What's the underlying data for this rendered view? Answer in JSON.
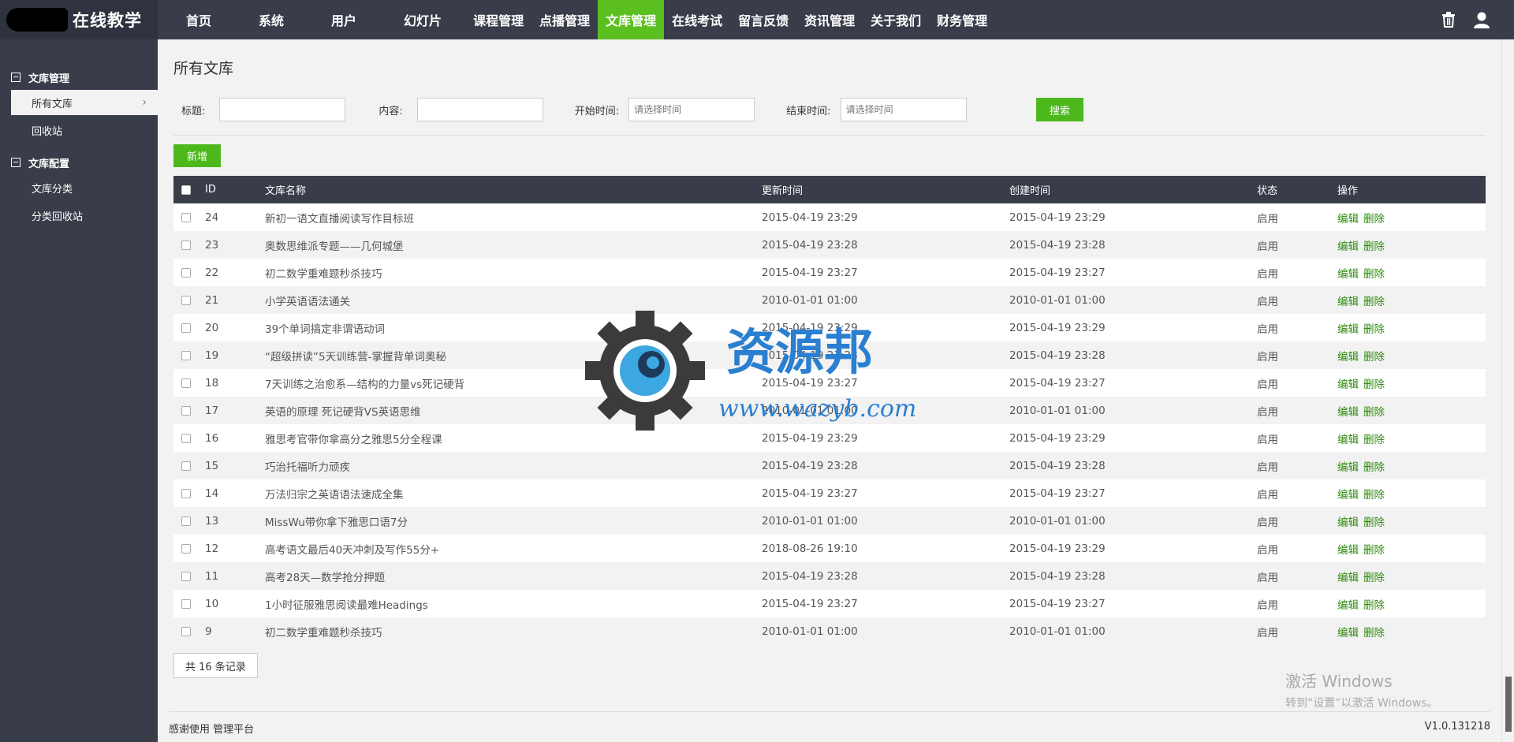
{
  "app": {
    "title": "在线教学"
  },
  "nav": [
    {
      "label": "首页",
      "wide": true
    },
    {
      "label": "系统",
      "wide": true
    },
    {
      "label": "用户",
      "wide": true
    },
    {
      "label": "幻灯片",
      "wide": true
    },
    {
      "label": "课程管理"
    },
    {
      "label": "点播管理"
    },
    {
      "label": "文库管理",
      "active": true
    },
    {
      "label": "在线考试"
    },
    {
      "label": "留言反馈"
    },
    {
      "label": "资讯管理"
    },
    {
      "label": "关于我们"
    },
    {
      "label": "财务管理"
    }
  ],
  "sidebar": {
    "groups": [
      {
        "label": "文库管理",
        "items": [
          {
            "label": "所有文库",
            "active": true
          },
          {
            "label": "回收站"
          }
        ]
      },
      {
        "label": "文库配置",
        "items": [
          {
            "label": "文库分类"
          },
          {
            "label": "分类回收站"
          }
        ]
      }
    ]
  },
  "page": {
    "title": "所有文库"
  },
  "filter": {
    "title_label": "标题:",
    "content_label": "内容:",
    "start_label": "开始时间:",
    "start_placeholder": "请选择时间",
    "end_label": "结束时间:",
    "end_placeholder": "请选择时间",
    "search_label": "搜索"
  },
  "toolbar": {
    "add_label": "新增"
  },
  "table": {
    "headers": {
      "id": "ID",
      "name": "文库名称",
      "updated": "更新时间",
      "created": "创建时间",
      "status": "状态",
      "ops": "操作"
    },
    "edit_label": "编辑",
    "delete_label": "删除",
    "rows": [
      {
        "id": "24",
        "name": "新初一语文直播阅读写作目标班",
        "updated": "2015-04-19 23:29",
        "created": "2015-04-19 23:29",
        "status": "启用"
      },
      {
        "id": "23",
        "name": "奥数思维派专题——几何城堡",
        "updated": "2015-04-19 23:28",
        "created": "2015-04-19 23:28",
        "status": "启用"
      },
      {
        "id": "22",
        "name": "初二数学重难题秒杀技巧",
        "updated": "2015-04-19 23:27",
        "created": "2015-04-19 23:27",
        "status": "启用"
      },
      {
        "id": "21",
        "name": "小学英语语法通关",
        "updated": "2010-01-01 01:00",
        "created": "2010-01-01 01:00",
        "status": "启用"
      },
      {
        "id": "20",
        "name": "39个单词搞定非谓语动词",
        "updated": "2015-04-19 23:29",
        "created": "2015-04-19 23:29",
        "status": "启用"
      },
      {
        "id": "19",
        "name": "“超级拼读”5天训练营-掌握背单词奥秘",
        "updated": "2015-04-19 23:28",
        "created": "2015-04-19 23:28",
        "status": "启用"
      },
      {
        "id": "18",
        "name": "7天训练之治愈系—结构的力量vs死记硬背",
        "updated": "2015-04-19 23:27",
        "created": "2015-04-19 23:27",
        "status": "启用"
      },
      {
        "id": "17",
        "name": "英语的原理 死记硬背VS英语思维",
        "updated": "2010-01-01 01:00",
        "created": "2010-01-01 01:00",
        "status": "启用"
      },
      {
        "id": "16",
        "name": "雅思考官带你拿高分之雅思5分全程课",
        "updated": "2015-04-19 23:29",
        "created": "2015-04-19 23:29",
        "status": "启用"
      },
      {
        "id": "15",
        "name": "巧治托福听力顽疾",
        "updated": "2015-04-19 23:28",
        "created": "2015-04-19 23:28",
        "status": "启用"
      },
      {
        "id": "14",
        "name": "万法归宗之英语语法速成全集",
        "updated": "2015-04-19 23:27",
        "created": "2015-04-19 23:27",
        "status": "启用"
      },
      {
        "id": "13",
        "name": "MissWu带你拿下雅思口语7分",
        "updated": "2010-01-01 01:00",
        "created": "2010-01-01 01:00",
        "status": "启用"
      },
      {
        "id": "12",
        "name": "高考语文最后40天冲刺及写作55分+",
        "updated": "2018-08-26 19:10",
        "created": "2015-04-19 23:29",
        "status": "启用"
      },
      {
        "id": "11",
        "name": "高考28天—数学抢分押题",
        "updated": "2015-04-19 23:28",
        "created": "2015-04-19 23:28",
        "status": "启用"
      },
      {
        "id": "10",
        "name": "1小时征服雅思阅读最难Headings",
        "updated": "2015-04-19 23:27",
        "created": "2015-04-19 23:27",
        "status": "启用"
      },
      {
        "id": "9",
        "name": "初二数学重难题秒杀技巧",
        "updated": "2010-01-01 01:00",
        "created": "2010-01-01 01:00",
        "status": "启用"
      }
    ]
  },
  "pagination": {
    "total_label": "共 16 条记录"
  },
  "footer": {
    "left": "感谢使用  管理平台",
    "version": "V1.0.131218"
  },
  "os_watermark": {
    "line1": "激活 Windows",
    "line2": "转到“设置”以激活 Windows。"
  },
  "site_watermark": {
    "title": "资源邦",
    "url": "www.wazyb.com"
  }
}
